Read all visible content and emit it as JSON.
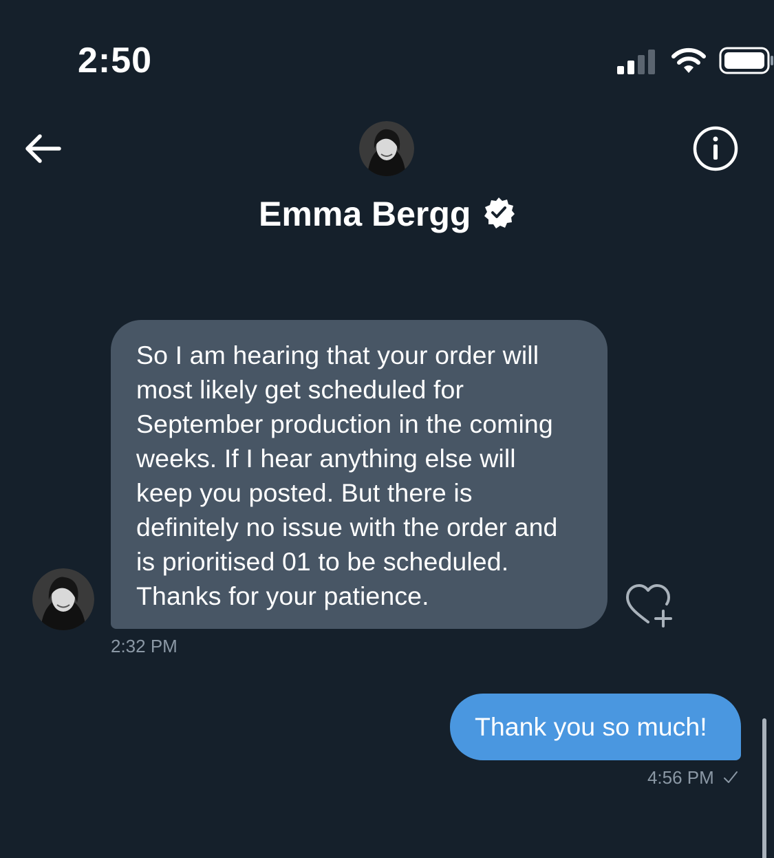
{
  "status_bar": {
    "time": "2:50",
    "icons": [
      "cellular-signal-icon",
      "wifi-icon",
      "battery-icon"
    ]
  },
  "header": {
    "back_icon": "arrow-left-icon",
    "info_icon": "info-icon",
    "contact_name": "Emma Bergg",
    "verified": true
  },
  "messages": [
    {
      "direction": "incoming",
      "text": "So I am hearing that your order will\nmost likely get scheduled for\nSeptember production in the coming\nweeks. If I hear anything else will\nkeep you posted. But there is\ndefinitely no issue with the order and\nis prioritised 01 to be scheduled.\nThanks for your patience.",
      "time": "2:32 PM",
      "reaction_icon": "heart-plus-icon"
    },
    {
      "direction": "outgoing",
      "text": "Thank you so much!",
      "time": "4:56 PM",
      "status_icon": "check-icon"
    }
  ],
  "colors": {
    "background": "#15202b",
    "incoming_bubble": "#485665",
    "outgoing_bubble": "#4a97e0",
    "meta_text": "#8b98a5"
  }
}
